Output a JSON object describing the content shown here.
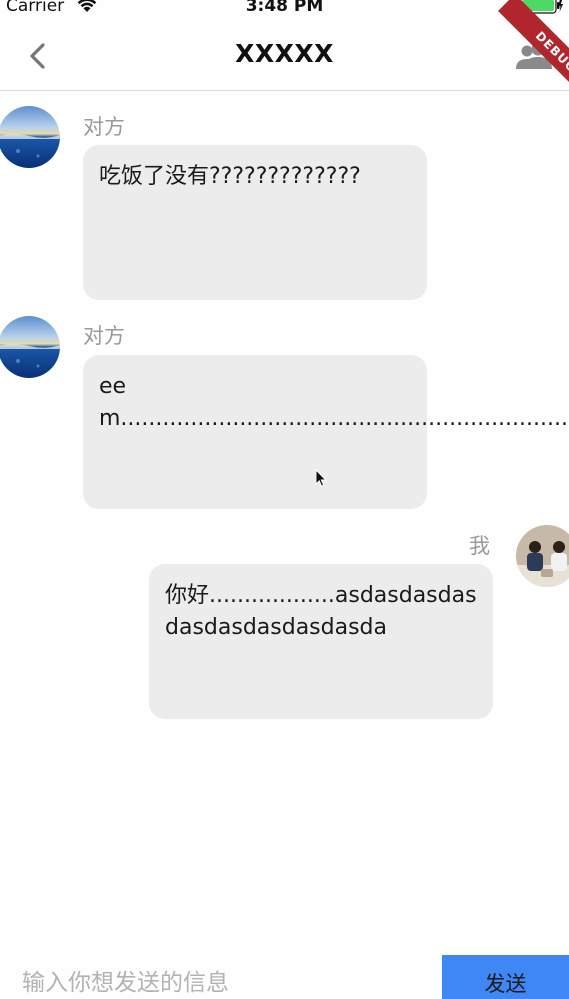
{
  "status_bar": {
    "carrier": "Carrier",
    "time": "3:48 PM",
    "wifi_icon": "wifi-icon",
    "battery_icon": "battery-icon",
    "battery_color": "#4cd964"
  },
  "nav": {
    "title": "XXXXX",
    "back_icon": "chevron-left-icon",
    "group_icon": "group-icon"
  },
  "debug_banner": "DEBUG",
  "messages": [
    {
      "sender": "对方",
      "side": "left",
      "avatar_icon": "ocean-avatar",
      "text": "吃饭了没有?????????????"
    },
    {
      "sender": "对方",
      "side": "left",
      "avatar_icon": "ocean-avatar",
      "text": "eem.............................................................................."
    },
    {
      "sender": "我",
      "side": "right",
      "avatar_icon": "photo-avatar",
      "text": "你好..................asdasdasdasdasdasdasdasdasda"
    }
  ],
  "composer": {
    "placeholder": "输入你想发送的信息",
    "value": "",
    "send_label": "发送"
  },
  "colors": {
    "bubble_bg": "#ececec",
    "send_button_bg": "#3f87f5",
    "debug_ribbon": "#b0262c",
    "sender_name": "#9a9a9a"
  }
}
